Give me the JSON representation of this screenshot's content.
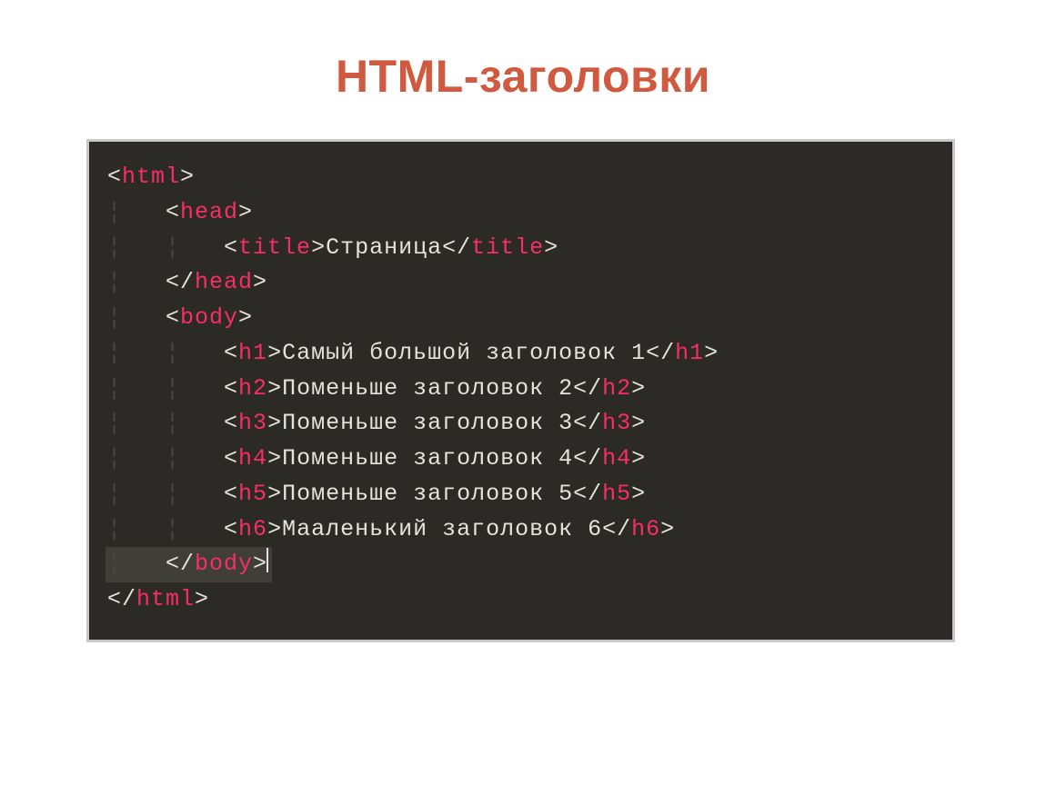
{
  "slide": {
    "title": "HTML-заголовки"
  },
  "code": {
    "tags": {
      "html": "html",
      "head": "head",
      "title": "title",
      "body": "body",
      "h1": "h1",
      "h2": "h2",
      "h3": "h3",
      "h4": "h4",
      "h5": "h5",
      "h6": "h6"
    },
    "text": {
      "title": "Страница",
      "h1": "Самый большой заголовок 1",
      "h2": "Поменьше заголовок 2",
      "h3": "Поменьше заголовок 3",
      "h4": "Поменьше заголовок 4",
      "h5": "Поменьше заголовок 5",
      "h6": "Мааленький заголовок 6"
    }
  }
}
